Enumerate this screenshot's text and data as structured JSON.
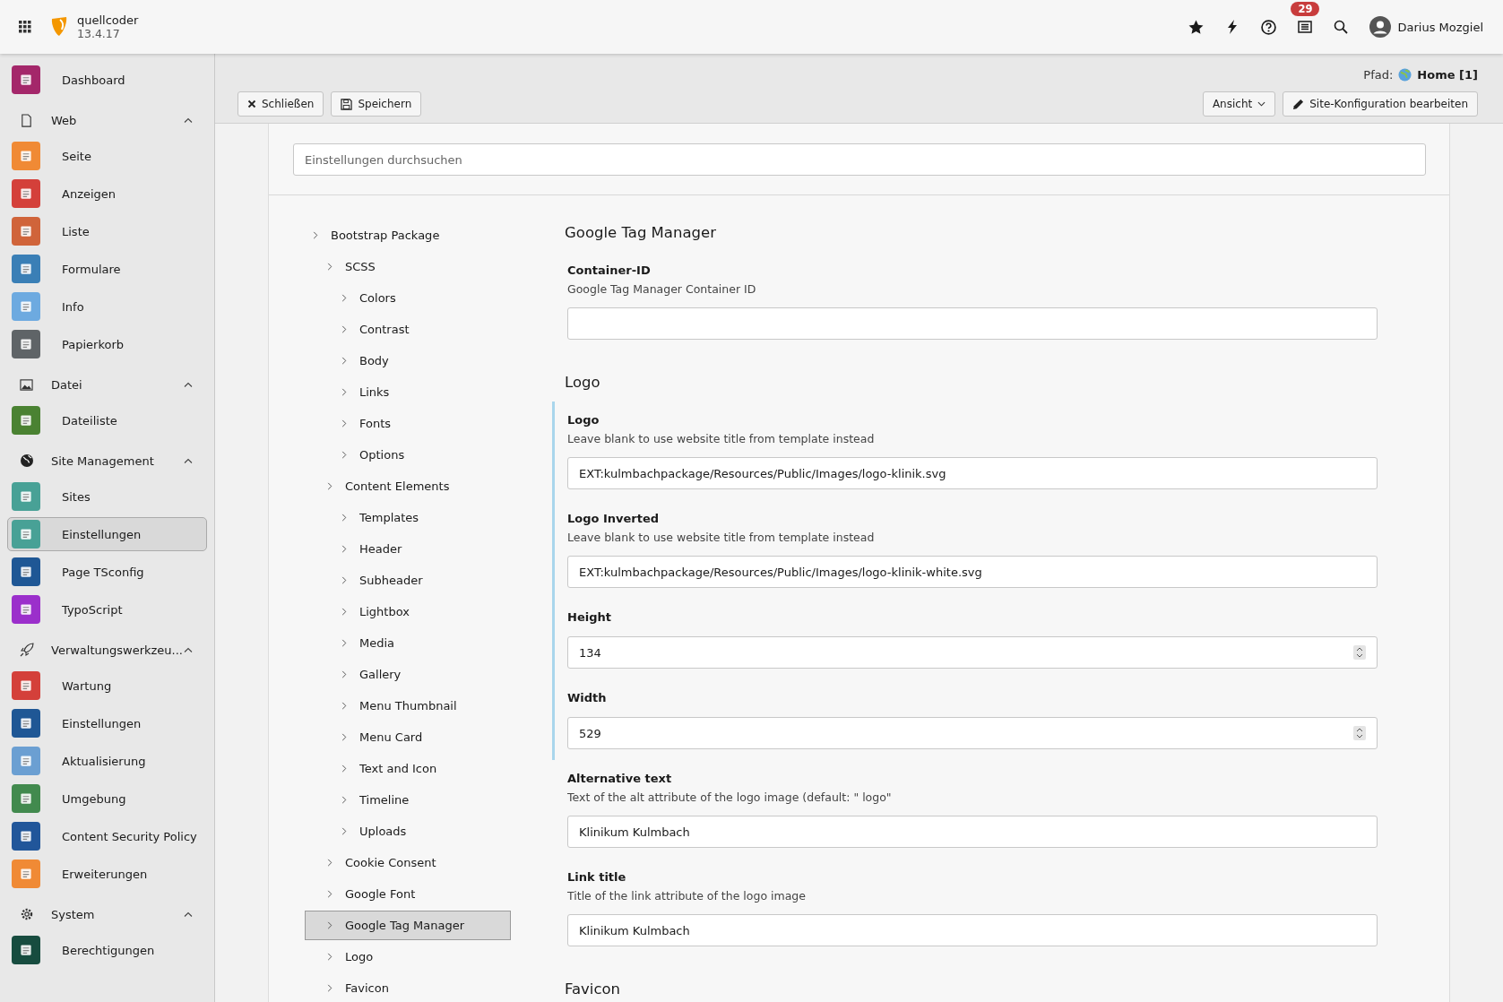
{
  "topbar": {
    "site_name": "quellcoder",
    "version": "13.4.17",
    "notification_count": "29",
    "user_name": "Darius Mozgiel"
  },
  "sidebar": {
    "top_items": [
      {
        "label": "Dashboard",
        "color": "#a4276a",
        "selected": false
      }
    ],
    "groups": [
      {
        "label": "Web",
        "expanded": true,
        "items": [
          {
            "label": "Seite",
            "color": "#f08a35",
            "selected": false
          },
          {
            "label": "Anzeigen",
            "color": "#d4403a",
            "selected": false
          },
          {
            "label": "Liste",
            "color": "#d0643a",
            "selected": false
          },
          {
            "label": "Formulare",
            "color": "#3a7fb6",
            "selected": false
          },
          {
            "label": "Info",
            "color": "#6daae0",
            "selected": false
          },
          {
            "label": "Papierkorb",
            "color": "#5f6467",
            "selected": false
          }
        ]
      },
      {
        "label": "Datei",
        "expanded": true,
        "items": [
          {
            "label": "Dateiliste",
            "color": "#4a8232",
            "selected": false
          }
        ]
      },
      {
        "label": "Site Management",
        "expanded": true,
        "items": [
          {
            "label": "Sites",
            "color": "#48a196",
            "selected": false
          },
          {
            "label": "Einstellungen",
            "color": "#48a196",
            "selected": true
          },
          {
            "label": "Page TSconfig",
            "color": "#1f5795",
            "selected": false
          },
          {
            "label": "TypoScript",
            "color": "#9b2fcb",
            "selected": false
          }
        ]
      },
      {
        "label": "Verwaltungswerkzeu...",
        "expanded": true,
        "items": [
          {
            "label": "Wartung",
            "color": "#d4403a",
            "selected": false
          },
          {
            "label": "Einstellungen",
            "color": "#1f5795",
            "selected": false
          },
          {
            "label": "Aktualisierung",
            "color": "#6b9fd2",
            "selected": false
          },
          {
            "label": "Umgebung",
            "color": "#428a4e",
            "selected": false
          },
          {
            "label": "Content Security Policy",
            "color": "#21569a",
            "selected": false
          },
          {
            "label": "Erweiterungen",
            "color": "#f08a35",
            "selected": false
          }
        ]
      },
      {
        "label": "System",
        "expanded": true,
        "items": [
          {
            "label": "Berechtigungen",
            "color": "#174c3f",
            "selected": false
          }
        ]
      }
    ]
  },
  "docheader": {
    "path_label": "Pfad:",
    "path_page": "Home [1]",
    "buttons": [
      {
        "label": "Schließen"
      },
      {
        "label": "Speichern"
      }
    ],
    "view_menu": "Ansicht",
    "edit_button": "Site-Konfiguration bearbeiten"
  },
  "search": {
    "placeholder": "Einstellungen durchsuchen"
  },
  "tree": [
    {
      "label": "Bootstrap Package",
      "selected": false,
      "children": [
        {
          "label": "SCSS",
          "selected": false,
          "children": [
            {
              "label": "Colors",
              "selected": false
            },
            {
              "label": "Contrast",
              "selected": false
            },
            {
              "label": "Body",
              "selected": false
            },
            {
              "label": "Links",
              "selected": false
            },
            {
              "label": "Fonts",
              "selected": false
            },
            {
              "label": "Options",
              "selected": false
            }
          ]
        },
        {
          "label": "Content Elements",
          "selected": false,
          "children": [
            {
              "label": "Templates",
              "selected": false
            },
            {
              "label": "Header",
              "selected": false
            },
            {
              "label": "Subheader",
              "selected": false
            },
            {
              "label": "Lightbox",
              "selected": false
            },
            {
              "label": "Media",
              "selected": false
            },
            {
              "label": "Gallery",
              "selected": false
            },
            {
              "label": "Menu Thumbnail",
              "selected": false
            },
            {
              "label": "Menu Card",
              "selected": false
            },
            {
              "label": "Text and Icon",
              "selected": false
            },
            {
              "label": "Timeline",
              "selected": false
            },
            {
              "label": "Uploads",
              "selected": false
            }
          ]
        },
        {
          "label": "Cookie Consent",
          "selected": false
        },
        {
          "label": "Google Font",
          "selected": false
        },
        {
          "label": "Google Tag Manager",
          "selected": true
        },
        {
          "label": "Logo",
          "selected": false
        },
        {
          "label": "Favicon",
          "selected": false
        }
      ]
    }
  ],
  "sections": [
    {
      "title": "Google Tag Manager",
      "fields": [
        {
          "label": "Container-ID",
          "description": "Google Tag Manager Container ID",
          "kind": "text",
          "modified": false
        }
      ]
    },
    {
      "title": "Logo",
      "fields": [
        {
          "label": "Logo",
          "description": "Leave blank to use website title from template instead",
          "kind": "text",
          "value": "EXT:kulmbachpackage/Resources/Public/Images/logo-klinik.svg",
          "modified": true
        },
        {
          "label": "Logo Inverted",
          "description": "Leave blank to use website title from template instead",
          "kind": "text",
          "value": "EXT:kulmbachpackage/Resources/Public/Images/logo-klinik-white.svg",
          "modified": true
        },
        {
          "label": "Height",
          "kind": "number",
          "value": "134",
          "modified": true
        },
        {
          "label": "Width",
          "kind": "number",
          "value": "529",
          "modified": true
        },
        {
          "label": "Alternative text",
          "description": "Text of the alt attribute of the logo image (default: \" logo\"",
          "kind": "text",
          "value": "Klinikum Kulmbach",
          "modified": false
        },
        {
          "label": "Link title",
          "description": "Title of the link attribute of the logo image",
          "kind": "text",
          "value": "Klinikum Kulmbach",
          "modified": false
        }
      ]
    },
    {
      "title": "Favicon"
    }
  ]
}
